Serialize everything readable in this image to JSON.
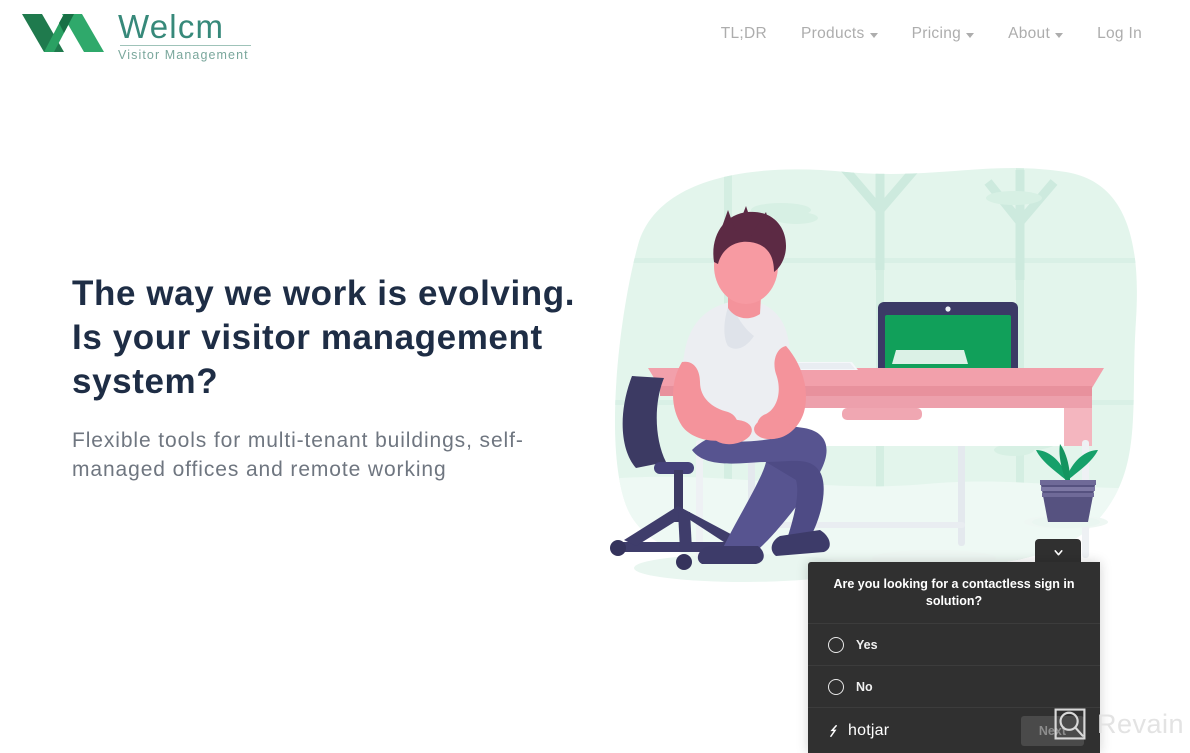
{
  "brand": {
    "logo_word": "Welcm",
    "logo_tagline": "Visitor Management",
    "logo_mark_icon": "welcm-w-logo-icon",
    "green_dark": "#1f7a4d",
    "green_light": "#2fa96b",
    "text_teal": "#37897a"
  },
  "nav": {
    "items": [
      {
        "label": "TL;DR",
        "has_caret": false
      },
      {
        "label": "Products",
        "has_caret": true
      },
      {
        "label": "Pricing",
        "has_caret": true
      },
      {
        "label": "About",
        "has_caret": true
      },
      {
        "label": "Log In",
        "has_caret": false
      }
    ]
  },
  "hero": {
    "headline": "The way we work is evolving. Is your visitor management system?",
    "subhead": "Flexible tools for multi-tenant buildings, self-managed offices and remote working",
    "headline_color": "#1e2d45",
    "subhead_color": "#6f7680",
    "illustration_name": "man-at-desk-illustration"
  },
  "survey": {
    "question": "Are you looking for a contactless sign in solution?",
    "options": [
      {
        "label": "Yes",
        "selected": false
      },
      {
        "label": "No",
        "selected": false
      }
    ],
    "vendor": "hotjar",
    "next_label": "Next",
    "collapse_icon": "chevron-down-icon",
    "panel_color": "#303030",
    "next_button_color": "#4a4a4a"
  },
  "watermark": {
    "text": "Revain",
    "icon": "magnifier-square-icon",
    "color": "#e3e3e3"
  }
}
